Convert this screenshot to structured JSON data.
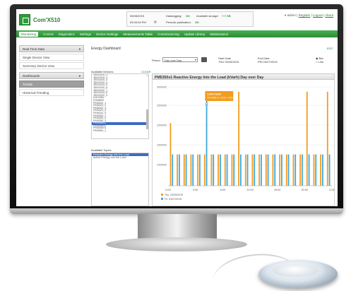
{
  "app": {
    "name": "Com'X510"
  },
  "status": {
    "date": "05/08/2015",
    "time": "05:34:04 PM",
    "datalogging_label": "Datalogging:",
    "datalogging_value": "OK",
    "storage_label": "Available storage:",
    "storage_value": "7.7 GB",
    "publication_label": "Periodic publication:",
    "publication_value": "OK"
  },
  "toplinks": {
    "user": "admin",
    "register": "Register",
    "logout": "Logout",
    "about": "About"
  },
  "nav": [
    "Monitoring",
    "Control",
    "Diagnostics",
    "Settings",
    "Device Settings",
    "Measurements Table",
    "Commissioning",
    "Update Library",
    "Maintenance"
  ],
  "sidebar": {
    "groups": [
      {
        "label": "Real Time Data",
        "items": [
          "Single Device View",
          "Summary Device View"
        ]
      },
      {
        "label": "Dashboards",
        "items": [
          "Trends",
          "Historical Trending"
        ]
      }
    ]
  },
  "content": {
    "title": "Energy Dashboard",
    "link": "EDIT",
    "devices_label": "Available Devices",
    "devices_clear": "CLEAR",
    "devices": [
      "JEM2020_1",
      "JEM2020_2",
      "JEM2020_3",
      "JEM2020_4",
      "JEM2020_5",
      "JEM2020_6",
      "JEM2020_7",
      "JEM2020_8",
      "JEM2020_9",
      "ION7650",
      "ION8600",
      "PM5320_1",
      "PM5320_2",
      "PM5320_3",
      "PM5320_4",
      "PM5320_5",
      "PM5350_1",
      "PM5350_2",
      "PM5350_3",
      "PM5350v1",
      "PM5350v2",
      "PM5350v3",
      "PM5560_1"
    ],
    "selected_device": "PM5350v1",
    "topics_label": "Available Topics",
    "topics": [
      "Reactive Energy Into the Load",
      "Active Energy Into the Load"
    ],
    "selected_topic": "Reactive Energy Into the Load"
  },
  "controls": {
    "period_label": "Period",
    "period_value": "Day over Day",
    "start_label": "Start Date",
    "start_value": "THU 03/26/2015",
    "end_label": "End Date",
    "end_value": "FRI 03/27/2015",
    "radio_bar": "Bar",
    "radio_line": "Line"
  },
  "chart_data": {
    "type": "bar",
    "title": "PM5350v1 Reactive Energy Into the Load (kVarh) Day over Day",
    "x_ticks": [
      "0:00",
      "4:00",
      "8:00",
      "12:00",
      "16:00",
      "20:00",
      "0:00"
    ],
    "y_ticks": [
      "3000000",
      "2500000",
      "2000000",
      "1500000",
      "1000000"
    ],
    "series": [
      {
        "name": "Thu, 03/26/2015",
        "color": "#f39c1e",
        "values": [
          2000,
          1000,
          1000,
          1000,
          1000,
          1000,
          1000,
          1000,
          1000,
          1000,
          3000,
          1000,
          1000,
          1000,
          1000,
          1000,
          1000,
          1000,
          1000,
          1000,
          3000,
          1000,
          1000,
          3000
        ]
      },
      {
        "name": "Fri, 03/27/2015",
        "color": "#3ea9dc",
        "values": [
          1000,
          1000,
          1000,
          1000,
          1000,
          3000,
          1000,
          1000,
          1000,
          1000,
          1000,
          1000,
          1000,
          1000,
          1000,
          1000,
          1000,
          1000,
          1000,
          1000,
          1000,
          1000,
          1000,
          1000
        ]
      }
    ],
    "tooltip": {
      "line1": "2,000 kVarh",
      "line2": "FRI MAR 27, 2015 - 4:00 AM"
    },
    "legend": [
      {
        "label": "Thu, 03/26/2015"
      },
      {
        "label": "Fri, 03/27/2015"
      }
    ]
  }
}
